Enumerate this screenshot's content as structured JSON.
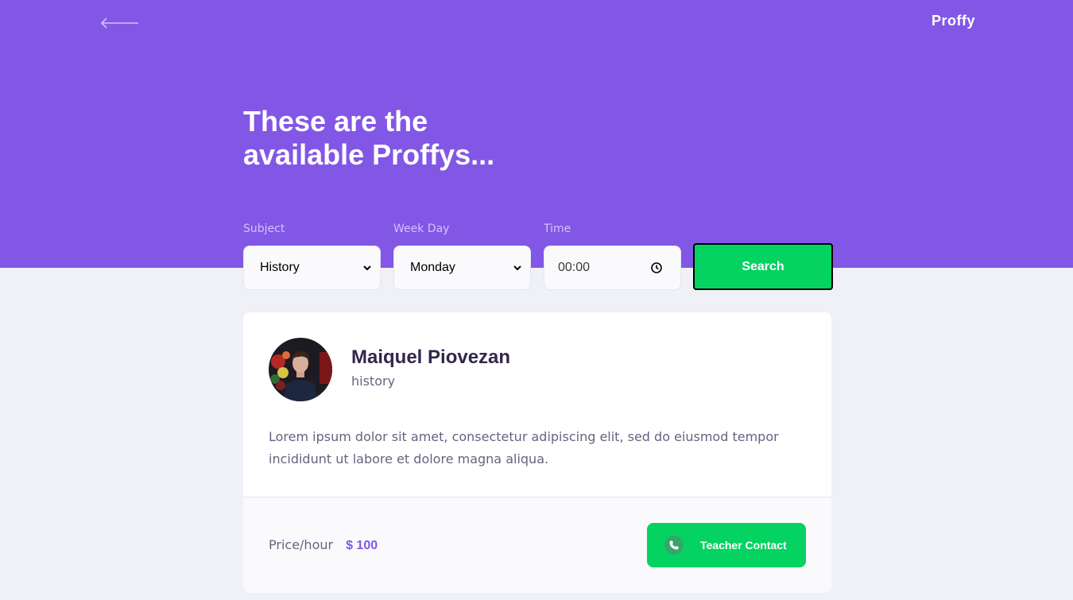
{
  "header": {
    "logo": "Proffy",
    "title_line1": "These are the",
    "title_line2": "available Proffys...",
    "back_icon": "arrow-left-icon"
  },
  "filters": {
    "subject": {
      "label": "Subject",
      "value": "History"
    },
    "week_day": {
      "label": "Week Day",
      "value": "Monday"
    },
    "time": {
      "label": "Time",
      "value": "00:00",
      "icon": "clock-icon"
    },
    "search_label": "Search"
  },
  "teacher": {
    "name": "Maiquel Piovezan",
    "subject": "history",
    "bio": "Lorem ipsum dolor sit amet, consectetur adipiscing elit, sed do eiusmod tempor incididunt ut labore et dolore magna aliqua.",
    "price_label": "Price/hour",
    "price_value": "$ 100",
    "contact_label": "Teacher Contact",
    "contact_icon": "whatsapp-icon"
  },
  "colors": {
    "primary": "#8257e5",
    "secondary": "#04d361",
    "background": "#f0f0f7",
    "text_title": "#32264d",
    "text_base": "#6a6180"
  }
}
